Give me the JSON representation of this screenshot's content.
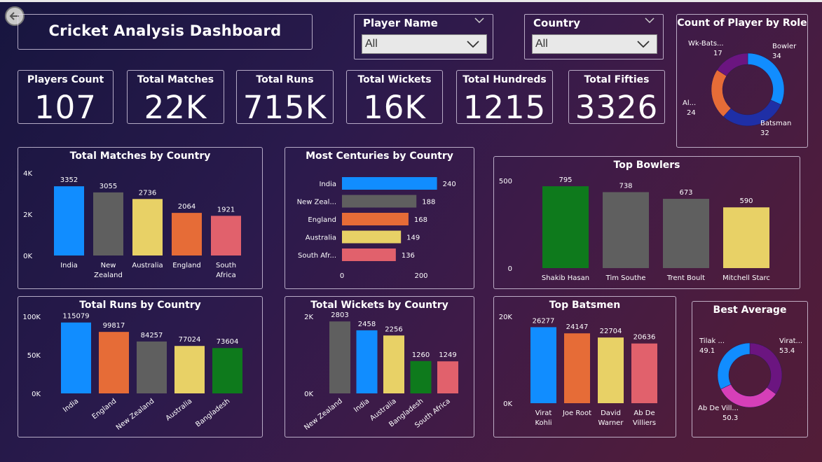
{
  "header": {
    "title": "Cricket  Analysis  Dashboard"
  },
  "filters": {
    "player": {
      "label": "Player Name",
      "value": "All"
    },
    "country": {
      "label": "Country",
      "value": "All"
    }
  },
  "kpis": [
    {
      "label": "Players Count",
      "value": "107"
    },
    {
      "label": "Total Matches",
      "value": "22K"
    },
    {
      "label": "Total Runs",
      "value": "715K"
    },
    {
      "label": "Total Wickets",
      "value": "16K"
    },
    {
      "label": "Total Hundreds",
      "value": "1215"
    },
    {
      "label": "Total Fifties",
      "value": "3326"
    }
  ],
  "colors": {
    "blue": "#118dff",
    "gray": "#5f5f5f",
    "yellow": "#e8d166",
    "orange": "#e66c37",
    "pink": "#e1616c",
    "green": "#0e7a1c",
    "navy": "#1f2fa6",
    "purple": "#6b1580",
    "magenta": "#d63fb8"
  },
  "chart_data": [
    {
      "id": "matches",
      "type": "bar",
      "title": "Total Matches by Country",
      "categories": [
        "India",
        "New\nZealand",
        "Australia",
        "England",
        "South\nAfrica"
      ],
      "values": [
        3352,
        3055,
        2736,
        2064,
        1921
      ],
      "ylim": [
        0,
        4000
      ],
      "yticks": [
        "0K",
        "2K",
        "4K"
      ],
      "colors": [
        "#118dff",
        "#5f5f5f",
        "#e8d166",
        "#e66c37",
        "#e1616c"
      ]
    },
    {
      "id": "centuries",
      "type": "bar",
      "orientation": "horizontal",
      "title": "Most Centuries by Country",
      "categories": [
        "India",
        "New Zeal...",
        "England",
        "Australia",
        "South Afr..."
      ],
      "values": [
        240,
        188,
        168,
        149,
        136
      ],
      "xlim": [
        0,
        260
      ],
      "xticks": [
        "0",
        "200"
      ],
      "colors": [
        "#118dff",
        "#5f5f5f",
        "#e66c37",
        "#e8d166",
        "#e1616c"
      ]
    },
    {
      "id": "bowlers",
      "type": "bar",
      "title": "Top Bowlers",
      "categories": [
        "Shakib Hasan",
        "Tim Southe",
        "Trent Boult",
        "Mitchell Starc"
      ],
      "values": [
        795,
        738,
        673,
        590
      ],
      "ylim": [
        0,
        850
      ],
      "yticks": [
        "0",
        "500"
      ],
      "colors": [
        "#0e7a1c",
        "#5f5f5f",
        "#5f5f5f",
        "#e8d166"
      ]
    },
    {
      "id": "runs",
      "type": "bar",
      "title": "Total Runs by Country",
      "categories": [
        "India",
        "England",
        "New Zealand",
        "Australia",
        "Bangladesh"
      ],
      "values": [
        115079,
        99817,
        84257,
        77024,
        73604
      ],
      "ylim": [
        0,
        125000
      ],
      "yticks": [
        "0K",
        "50K",
        "100K"
      ],
      "colors": [
        "#118dff",
        "#e66c37",
        "#5f5f5f",
        "#e8d166",
        "#0e7a1c"
      ]
    },
    {
      "id": "wickets",
      "type": "bar",
      "title": "Total Wickets by Country",
      "categories": [
        "New Zealand",
        "India",
        "Australia",
        "Bangladesh",
        "South Africa"
      ],
      "values": [
        2803,
        2458,
        2256,
        1260,
        1249
      ],
      "ylim": [
        0,
        3000
      ],
      "yticks": [
        "0K",
        "2K"
      ],
      "colors": [
        "#5f5f5f",
        "#118dff",
        "#e8d166",
        "#0e7a1c",
        "#e1616c"
      ]
    },
    {
      "id": "batsmen",
      "type": "bar",
      "title": "Top Batsmen",
      "categories": [
        "Virat\nKohli",
        "Joe Root",
        "David\nWarner",
        "Ab De\nVilliers"
      ],
      "values": [
        26277,
        24147,
        22704,
        20636
      ],
      "ylim": [
        0,
        30000
      ],
      "yticks": [
        "0K",
        "20K"
      ],
      "colors": [
        "#118dff",
        "#e66c37",
        "#e8d166",
        "#e1616c"
      ]
    },
    {
      "id": "roles",
      "type": "pie",
      "donut": true,
      "title": "Count of Player by Role",
      "labels": [
        "Bowler",
        "Batsman",
        "Al...",
        "Wk-Bats..."
      ],
      "values": [
        34,
        32,
        24,
        17
      ],
      "colors": [
        "#118dff",
        "#1f2fa6",
        "#e66c37",
        "#6b1580"
      ]
    },
    {
      "id": "average",
      "type": "pie",
      "donut": true,
      "title": "Best Average",
      "labels": [
        "Virat...",
        "Ab De Vill...",
        "Tilak ..."
      ],
      "values": [
        53.4,
        50.3,
        49.1
      ],
      "colors": [
        "#6b1580",
        "#d63fb8",
        "#118dff"
      ]
    }
  ]
}
